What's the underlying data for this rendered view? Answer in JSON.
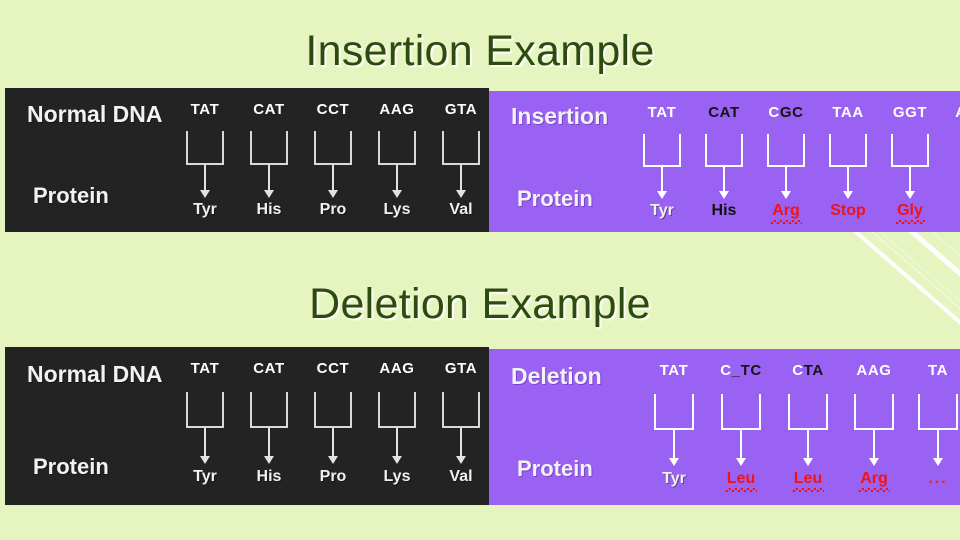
{
  "slide": {
    "background_color": "#e6f5c0",
    "title_color": "#2d4b10",
    "titles": {
      "insertion": "Insertion Example",
      "deletion": "Deletion Example"
    }
  },
  "colors": {
    "dark_panel": "#232323",
    "purple_panel": "#9a62f2",
    "mutation_text": "#f01414",
    "normal_text": "#ffffff",
    "changed_base": "#141414"
  },
  "panels": {
    "normal_top": {
      "background": "#232323",
      "dna_label": "Normal DNA",
      "protein_label": "Protein",
      "columns": [
        {
          "codon": "TAT",
          "codon_color": "white",
          "amino": "Tyr",
          "amino_color": "white",
          "bracket": true,
          "squiggle": false
        },
        {
          "codon": "CAT",
          "codon_color": "white",
          "amino": "His",
          "amino_color": "white",
          "bracket": true,
          "squiggle": false
        },
        {
          "codon": "CCT",
          "codon_color": "white",
          "amino": "Pro",
          "amino_color": "white",
          "bracket": true,
          "squiggle": false
        },
        {
          "codon": "AAG",
          "codon_color": "white",
          "amino": "Lys",
          "amino_color": "white",
          "bracket": true,
          "squiggle": false
        },
        {
          "codon": "GTA",
          "codon_color": "white",
          "amino": "Val",
          "amino_color": "white",
          "bracket": true,
          "squiggle": false
        }
      ]
    },
    "insertion": {
      "background": "#9a62f2",
      "dna_label": "Insertion",
      "protein_label": "Protein",
      "columns": [
        {
          "codon": "TAT",
          "codon_color": "white",
          "amino": "Tyr",
          "amino_color": "white",
          "bracket": true,
          "squiggle": false
        },
        {
          "codon": "CAT",
          "codon_color": "black",
          "amino": "His",
          "amino_color": "black",
          "bracket": true,
          "squiggle": false
        },
        {
          "codon": "CGC",
          "codon_color": "mixed",
          "codon_parts": [
            {
              "text": "C",
              "color": "white"
            },
            {
              "text": "GC",
              "color": "black"
            }
          ],
          "amino": "Arg",
          "amino_color": "red",
          "bracket": true,
          "squiggle": true
        },
        {
          "codon": "TAA",
          "codon_color": "white",
          "amino": "Stop",
          "amino_color": "red",
          "bracket": true,
          "squiggle": false
        },
        {
          "codon": "GGT",
          "codon_color": "white",
          "amino": "Gly",
          "amino_color": "red",
          "bracket": true,
          "squiggle": true
        },
        {
          "codon": "A",
          "codon_color": "white",
          "amino": "",
          "amino_color": "white",
          "bracket": false,
          "squiggle": false
        }
      ]
    },
    "normal_bottom": {
      "background": "#232323",
      "dna_label": "Normal DNA",
      "protein_label": "Protein",
      "columns": [
        {
          "codon": "TAT",
          "codon_color": "white",
          "amino": "Tyr",
          "amino_color": "white",
          "bracket": true,
          "squiggle": false
        },
        {
          "codon": "CAT",
          "codon_color": "white",
          "amino": "His",
          "amino_color": "white",
          "bracket": true,
          "squiggle": false
        },
        {
          "codon": "CCT",
          "codon_color": "white",
          "amino": "Pro",
          "amino_color": "white",
          "bracket": true,
          "squiggle": false
        },
        {
          "codon": "AAG",
          "codon_color": "white",
          "amino": "Lys",
          "amino_color": "white",
          "bracket": true,
          "squiggle": false
        },
        {
          "codon": "GTA",
          "codon_color": "white",
          "amino": "Val",
          "amino_color": "white",
          "bracket": true,
          "squiggle": false
        }
      ]
    },
    "deletion": {
      "background": "#9a62f2",
      "dna_label": "Deletion",
      "protein_label": "Protein",
      "columns": [
        {
          "codon": "TAT",
          "codon_color": "white",
          "amino": "Tyr",
          "amino_color": "white",
          "bracket": true,
          "squiggle": false
        },
        {
          "codon": "C_TC",
          "codon_color": "mixed",
          "codon_parts": [
            {
              "text": "C",
              "color": "white"
            },
            {
              "text": "_TC",
              "color": "black"
            }
          ],
          "amino": "Leu",
          "amino_color": "red",
          "bracket": true,
          "squiggle": true
        },
        {
          "codon": "CTA",
          "codon_color": "mixed",
          "codon_parts": [
            {
              "text": "C",
              "color": "white"
            },
            {
              "text": "TA",
              "color": "black"
            }
          ],
          "amino": "Leu",
          "amino_color": "red",
          "bracket": true,
          "squiggle": true
        },
        {
          "codon": "AAG",
          "codon_color": "white",
          "amino": "Arg",
          "amino_color": "red",
          "bracket": true,
          "squiggle": true
        },
        {
          "codon": "TA",
          "codon_color": "white",
          "amino": "...",
          "amino_color": "redmuted",
          "bracket": true,
          "squiggle": false
        }
      ]
    }
  }
}
